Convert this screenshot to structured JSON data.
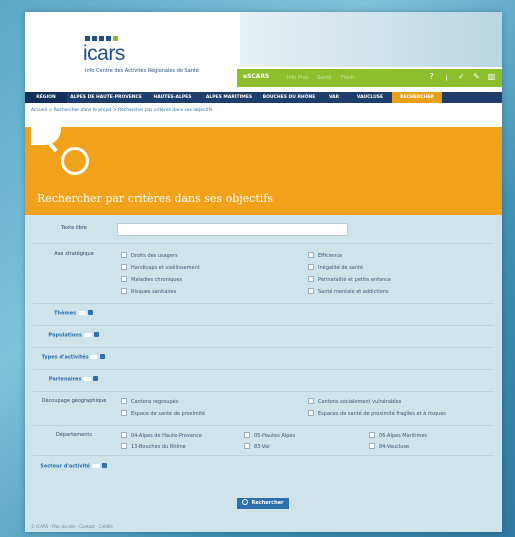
{
  "header": {
    "logo_text": "icars",
    "logo_subtitle": "Info Centre des Activités Régionales de Santé",
    "bar_brand": "eSCARS",
    "bar_faded": [
      "Info Plus",
      "Santé",
      "Flash"
    ],
    "icons": [
      "help-icon",
      "info-icon",
      "thumbs-up-icon",
      "tools-icon",
      "books-icon"
    ]
  },
  "nav": {
    "items": [
      "Région",
      "Alpes de Haute-Provence",
      "Hautes-Alpes",
      "Alpes Maritimes",
      "Bouches du Rhône",
      "Var",
      "Vaucluse",
      "Rechercher"
    ]
  },
  "breadcrumb": "Accueil > Rechercher dans le projet > Rechercher par critères dans ses objectifs",
  "banner": {
    "title": "Rechercher par critères dans ses objectifs"
  },
  "form": {
    "texte_libre_label": "Texte libre",
    "texte_libre_value": "",
    "axe_label": "Axe stratégique",
    "axe_options_left": [
      "Droits des usagers",
      "Handicaps et vieillissement",
      "Maladies chroniques",
      "Risques sanitaires"
    ],
    "axe_options_right": [
      "Efficience",
      "Inégalité de santé",
      "Périnatalité et petite enfance",
      "Santé mentale et addictions"
    ],
    "themes_label": "Thèmes",
    "populations_label": "Populations",
    "types_label": "Types d'activités",
    "partenaires_label": "Partenaires",
    "decoupage_label": "Découpage géographique",
    "decoupage_left": [
      "Cantons regroupés",
      "Espace de santé de proximité"
    ],
    "decoupage_right": [
      "Cantons socialement vulnérables",
      "Espaces de santé de proximité fragiles et à risques"
    ],
    "departements_label": "Départements",
    "departements": [
      "04-Alpes de Haute-Provence",
      "05-Hautes Alpes",
      "06-Alpes Maritimes",
      "13-Bouches du Rhône",
      "83-Var",
      "84-Vaucluse"
    ],
    "secteur_label": "Secteur d'activité",
    "search_button": "Rechercher"
  },
  "footer": {
    "text": "© ICARS · Plan du site · Contact · Crédits"
  }
}
